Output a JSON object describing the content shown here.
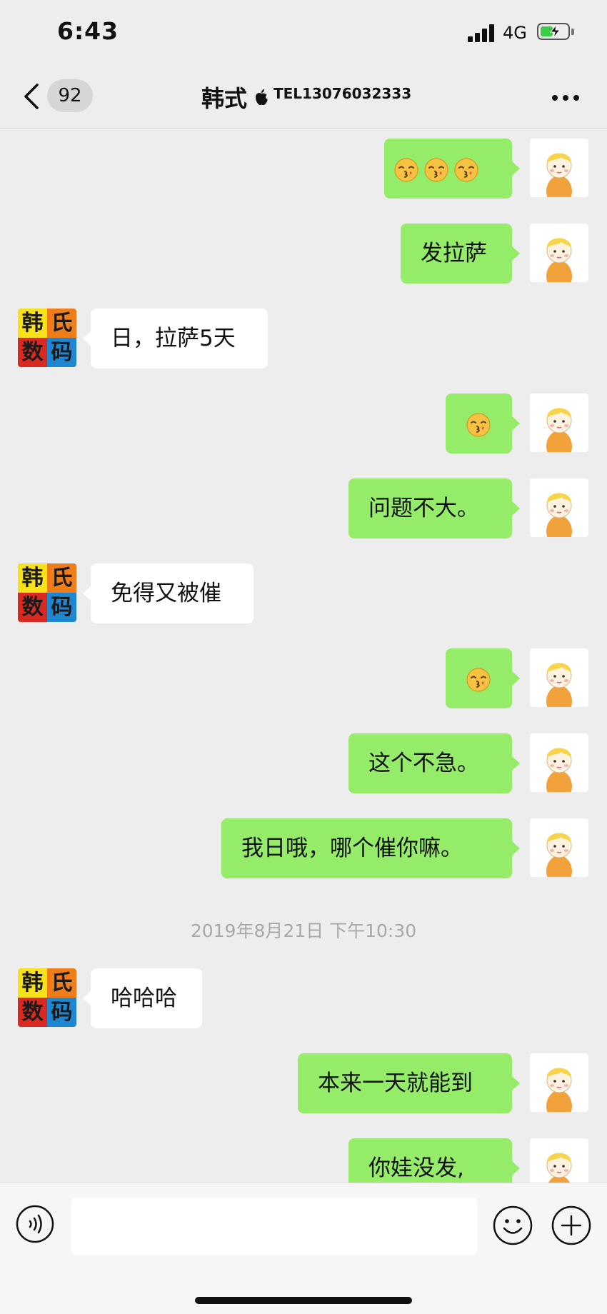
{
  "status_bar": {
    "time": "6:43",
    "network": "4G"
  },
  "nav": {
    "unread_count": "92",
    "contact_name": "韩式",
    "contact_subtitle": "TEL13076032333"
  },
  "avatars": {
    "contact": [
      "韩",
      "氏",
      "数",
      "码"
    ],
    "contact_colors": [
      "#f7e21a",
      "#ef7d1a",
      "#d82a22",
      "#1f87d2"
    ],
    "self": "cartoon-boy-avatar"
  },
  "messages": [
    {
      "sender": "me",
      "text": "",
      "emoji": [
        "kiss-face",
        "kiss-face",
        "kiss-face"
      ]
    },
    {
      "sender": "me",
      "text": "发拉萨"
    },
    {
      "sender": "them",
      "text": "日，拉萨5天"
    },
    {
      "sender": "me",
      "text": "",
      "emoji": [
        "kiss-face"
      ]
    },
    {
      "sender": "me",
      "text": "问题不大。"
    },
    {
      "sender": "them",
      "text": "免得又被催"
    },
    {
      "sender": "me",
      "text": "",
      "emoji": [
        "kiss-face"
      ]
    },
    {
      "sender": "me",
      "text": "这个不急。"
    },
    {
      "sender": "me",
      "text": "我日哦，哪个催你嘛。"
    },
    {
      "sender": "them",
      "text": "哈哈哈"
    },
    {
      "sender": "me",
      "text": "本来一天就能到"
    },
    {
      "sender": "me",
      "text": "你娃没发,"
    }
  ],
  "timestamp": "2019年8月21日 下午10:30",
  "colors": {
    "my_bubble": "#95ec69",
    "their_bubble": "#ffffff",
    "background": "#ededed"
  }
}
